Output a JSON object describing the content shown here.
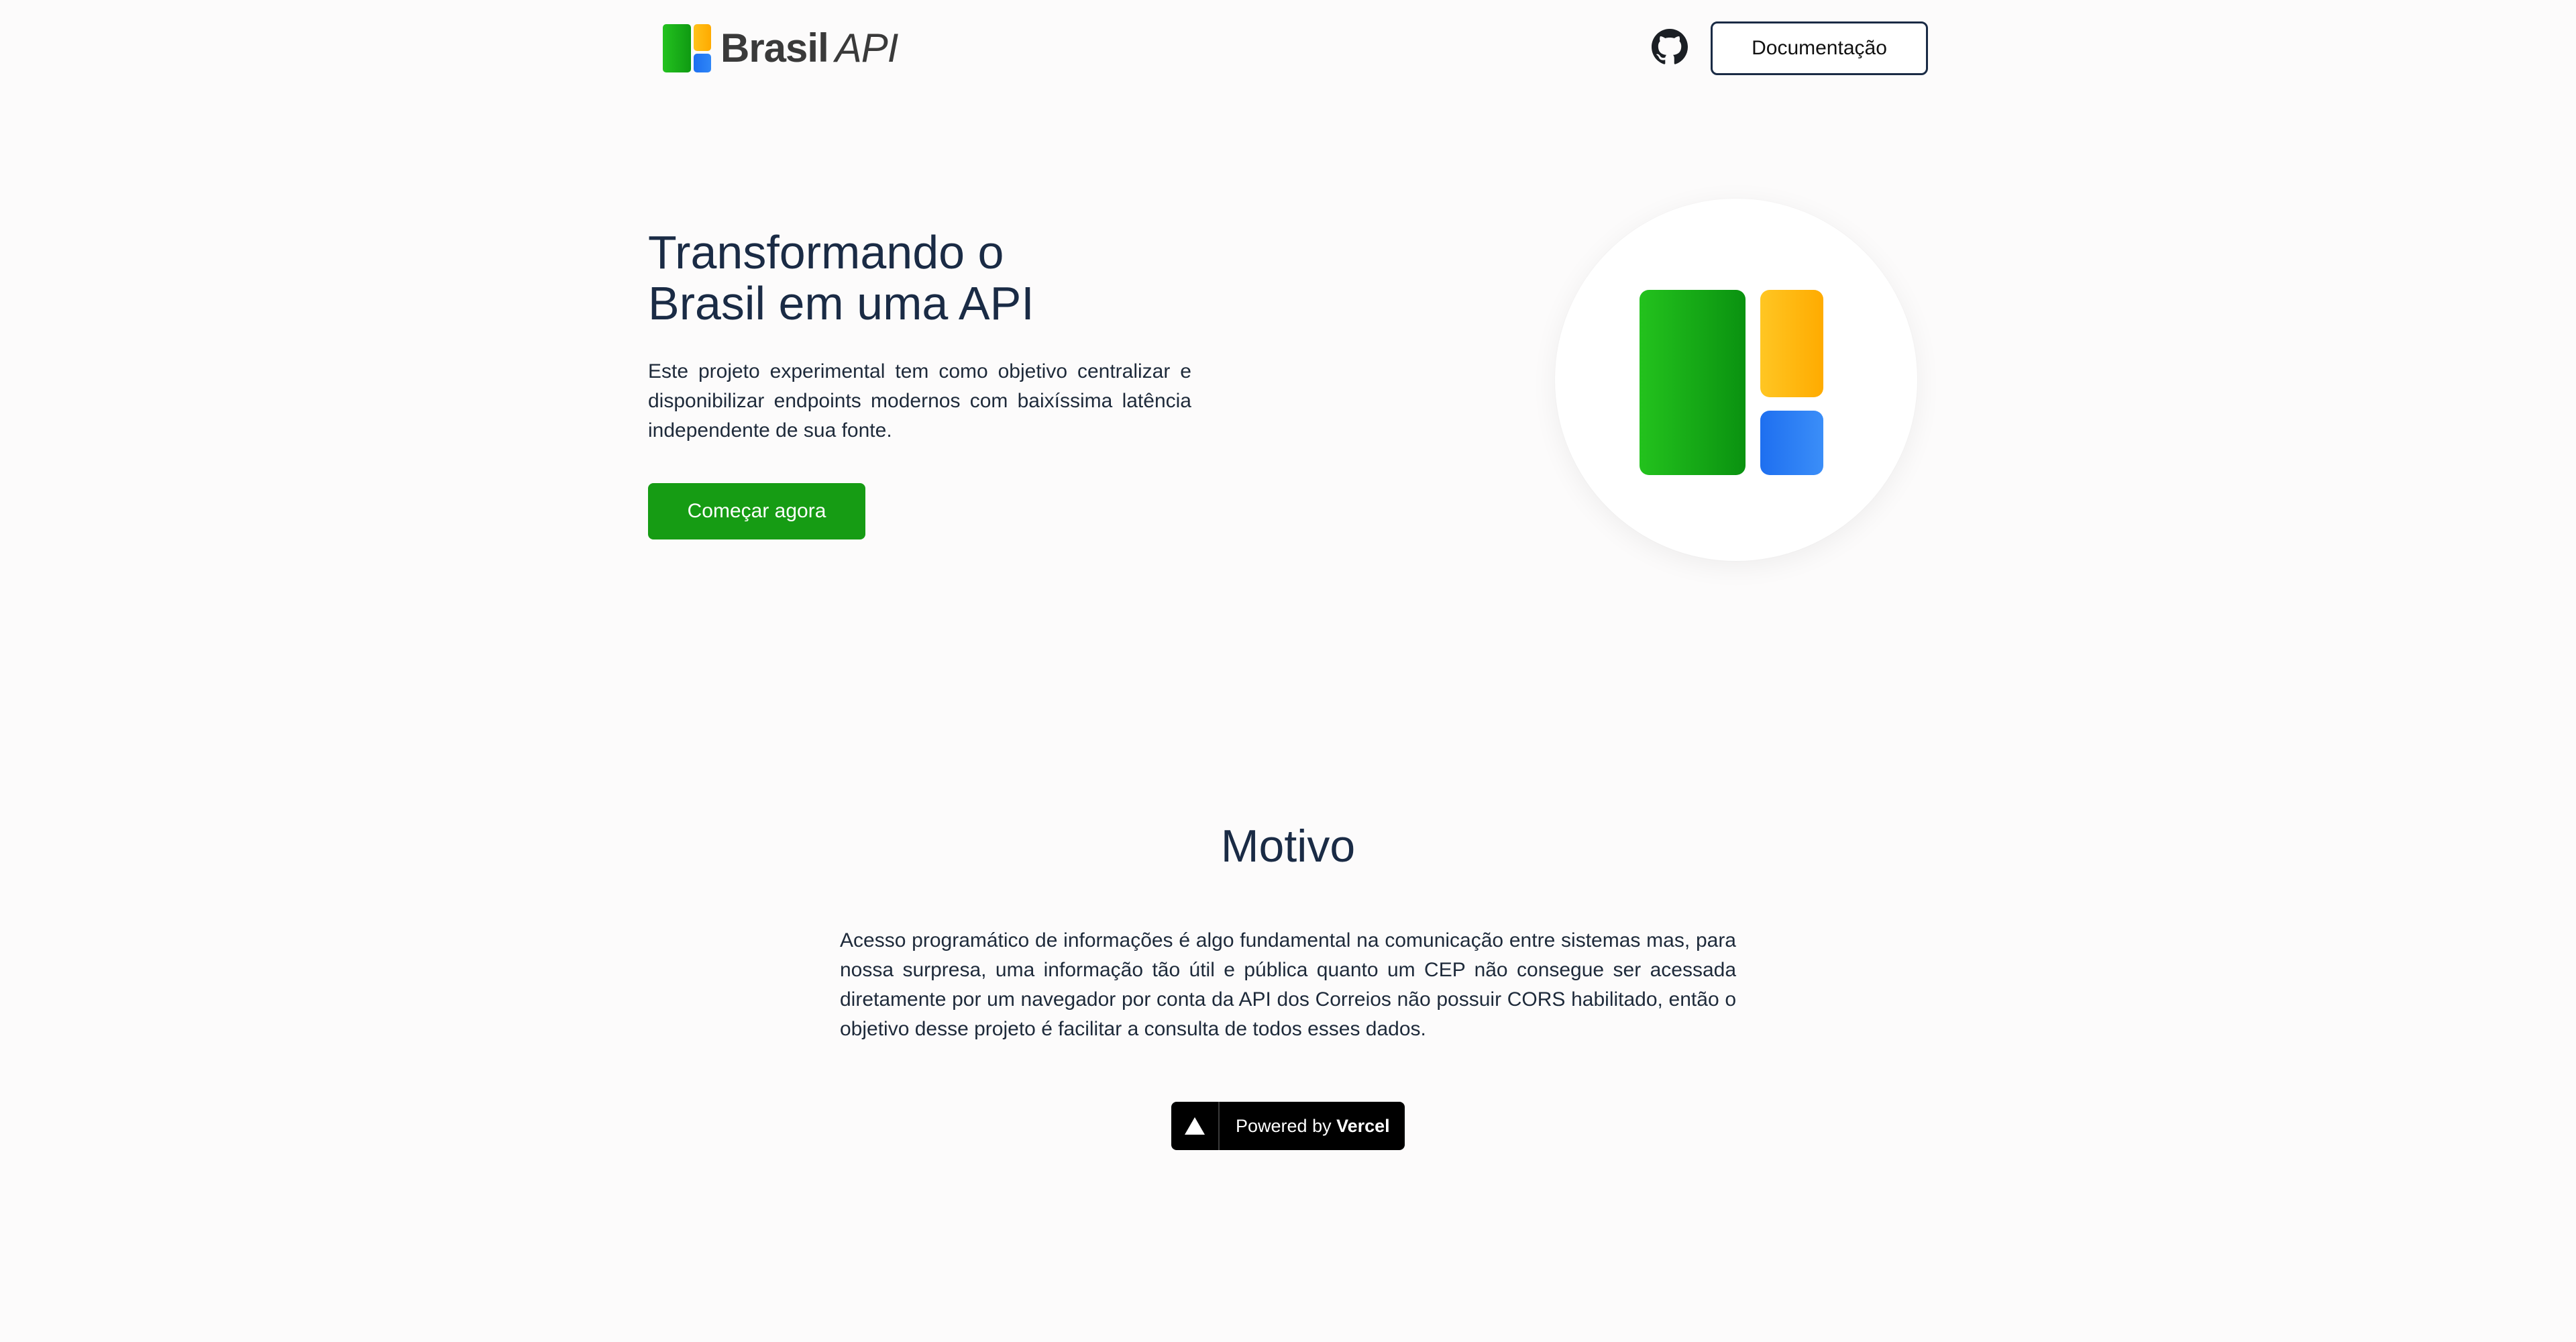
{
  "header": {
    "logo": {
      "brand": "Brasil",
      "suffix": "API"
    },
    "github_icon": "github-icon",
    "doc_button_label": "Documentação"
  },
  "hero": {
    "title_line1": "Transformando o",
    "title_line2": "Brasil em uma API",
    "description": "Este projeto experimental tem como objetivo centralizar e disponibilizar endpoints modernos com baixíssima latência independente de sua fonte.",
    "cta_label": "Começar agora"
  },
  "motivo": {
    "title": "Motivo",
    "text": "Acesso programático de informações é algo fundamental na comunicação entre sistemas mas, para nossa surpresa, uma informação tão útil e pública quanto um CEP não consegue ser acessada diretamente por um navegador por conta da API dos Correios não possuir CORS habilitado, então o objetivo desse projeto é facilitar a consulta de todos esses dados."
  },
  "footer": {
    "badge_prefix": "Powered by",
    "badge_brand": "Vercel",
    "badge_icon": "vercel-triangle-icon"
  },
  "colors": {
    "background": "#fcfbfb",
    "text": "#1a2b45",
    "primary_green": "#169c14",
    "logo_green": "#1bb016",
    "logo_yellow": "#ffb80d",
    "logo_blue": "#2577f2",
    "badge_black": "#000000"
  }
}
